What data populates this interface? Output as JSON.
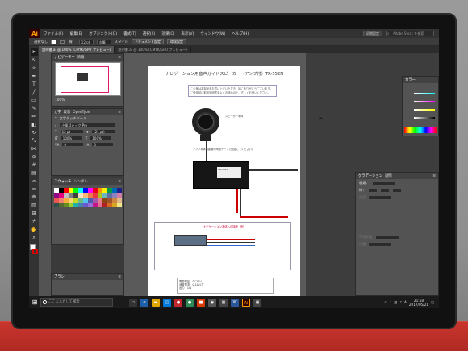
{
  "app": {
    "logo": "Ai"
  },
  "menubar": {
    "items": [
      "ファイル(F)",
      "編集(E)",
      "オブジェクト(O)",
      "書式(T)",
      "選択(S)",
      "効果(C)",
      "表示(V)",
      "ウィンドウ(W)",
      "ヘルプ(H)"
    ],
    "workspace": "初期設定",
    "stock_search_placeholder": "Adobe Stock を検索"
  },
  "controlbar": {
    "selection_label": "選択なし",
    "stroke_label": "線：",
    "stroke_width": "12 pt",
    "profile": "丸筆",
    "style_label": "スタイル",
    "document_setup": "ドキュメント設定",
    "preferences": "環境設定"
  },
  "tabs": [
    {
      "label": "説明書.ai @ 100% (CMYK/GPU プレビュー)",
      "active": true
    },
    {
      "label": "説明書.ai @ 100% (CMYK/GPU プレビュー)",
      "active": false
    }
  ],
  "navigator": {
    "tab1": "ナビゲーター",
    "tab2": "情報",
    "zoom": "100%"
  },
  "character": {
    "tab1": "文字",
    "tab2": "段落",
    "tab3": "OpenType",
    "touch_tool": "文字タッチツール",
    "font": "小塚ゴシック Pro",
    "size": "12 pt",
    "leading": "(21 pt)",
    "scale_v": "100%",
    "scale_h": "100%",
    "tracking": "0",
    "baseline": "0"
  },
  "swatches": {
    "tab1": "スウォッチ",
    "tab2": "シンボル",
    "colors": [
      "#ffffff",
      "#000000",
      "#ff0000",
      "#ffff00",
      "#00ff00",
      "#00ffff",
      "#0000ff",
      "#ff00ff",
      "#e60012",
      "#f39800",
      "#fff100",
      "#009944",
      "#0068b7",
      "#1d2088",
      "#920783",
      "#e4007f",
      "#c0c0c0",
      "#808080",
      "#404040",
      "#fce2c4",
      "#f7b977",
      "#ee7948",
      "#e8383d",
      "#a4c520",
      "#6bb6bb",
      "#5f6fa4",
      "#8f82bc",
      "#cf7ca9",
      "#ea5550",
      "#ee836f",
      "#f6ad3c",
      "#fcd575",
      "#c3d825",
      "#69bd83",
      "#54c3f1",
      "#4d5aaf",
      "#a757a8",
      "#e97a8d",
      "#8b4513",
      "#a0522d",
      "#cd853f",
      "#deb887",
      "#2f4f4f",
      "#556b2f",
      "#6b8e23",
      "#9acd32",
      "#20b2aa",
      "#4682b4",
      "#6a5acd",
      "#9370db",
      "#c71585",
      "#db7093",
      "#b22222",
      "#d2691e",
      "#daa520",
      "#f0e68c"
    ]
  },
  "brush": {
    "tab1": "ブラシ"
  },
  "artboard": {
    "title": "ナビゲーション用音声ガイドスピーカー（アンプ付）TR-552N",
    "description": "この度は本製品をお買い上げいただき、誠にありがとうございます。ご使用前に取扱説明書をよくお読みの上、正しくお使いください。",
    "speaker_note": "スピーカー本体",
    "amp_note": "アンプ本体（裏面の両面テープで固定してください）",
    "amp_plate": "TR-552N",
    "connector_title": "ナビゲーション本体への接続（例）",
    "spec_line1": "電源電圧　DC12V",
    "spec_line2": "消費電流　0.1A以下",
    "spec_line3": "出力　1W"
  },
  "color_panel": {
    "tab": "カラー"
  },
  "gradient_panel": {
    "tab1": "グラデーション",
    "tab2": "透明",
    "type_label": "種類：",
    "stroke_label": "線：",
    "angle_label": "角度",
    "opacity_label": "不透明度",
    "position_label": "位置"
  },
  "taskbar": {
    "search_placeholder": "ここに入力して検索",
    "time": "21:58",
    "date": "2017/05/21",
    "ime": "A"
  }
}
